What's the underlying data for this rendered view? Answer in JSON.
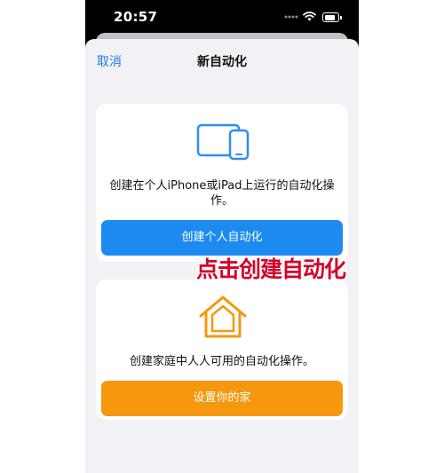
{
  "status_bar": {
    "time": "20:57",
    "icons": [
      "signal-icon",
      "wifi-icon",
      "battery-icon"
    ]
  },
  "nav": {
    "cancel_label": "取消",
    "title": "新自动化"
  },
  "personal_card": {
    "icon": "iphone-ipad-icon",
    "description": "创建在个人iPhone或iPad上运行的自动化操作。",
    "button_label": "创建个人自动化"
  },
  "home_card": {
    "icon": "home-icon",
    "description": "创建家庭中人人可用的自动化操作。",
    "button_label": "设置你的家"
  },
  "annotation": {
    "text": "点击创建自动化"
  },
  "colors": {
    "accent_blue": "#1d8af0",
    "accent_orange": "#f5980d",
    "annotation_red": "#d6002a",
    "sheet_background": "#f1f1f6"
  }
}
